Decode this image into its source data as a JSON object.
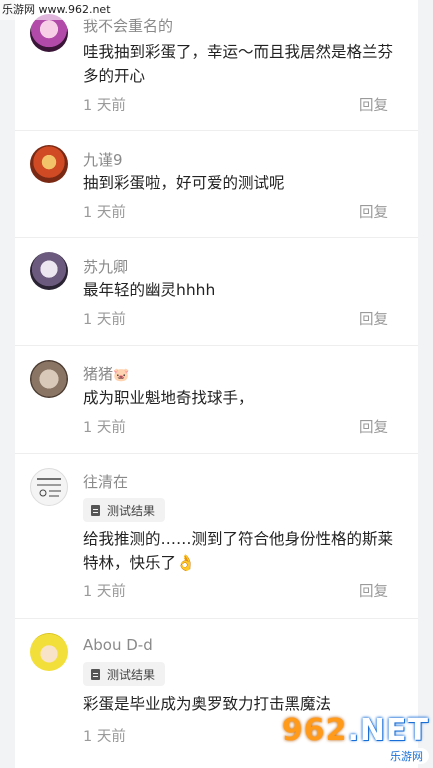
{
  "watermark": "乐游网 www.962.net",
  "reply_label": "回复",
  "tag_label": "测试结果",
  "comments": [
    {
      "name": "我不会重名的",
      "text": "哇我抽到彩蛋了，幸运～而且我居然是格兰芬多的开心",
      "time": "1 天前"
    },
    {
      "name": "九谨9",
      "text": "抽到彩蛋啦，好可爱的测试呢",
      "time": "1 天前"
    },
    {
      "name": "苏九卿",
      "text": "最年轻的幽灵hhhh",
      "time": "1 天前"
    },
    {
      "name": "猪猪",
      "name_emoji": "🐷",
      "text": "成为职业魁地奇找球手，",
      "time": "1 天前"
    },
    {
      "name": "往清在",
      "text": "给我推测的……测到了符合他身份性格的斯莱特林，快乐了👌",
      "time": "1 天前"
    },
    {
      "name": "Abou D-d",
      "text": "彩蛋是毕业成为奥罗致力打击黑魔法",
      "time": "1 天前"
    }
  ],
  "logo": {
    "text_main": "962",
    "text_suffix": ".NET",
    "subtitle": "乐游网"
  },
  "colors": {
    "background": "#f2f3f5",
    "card": "#ffffff",
    "muted": "#9a9a9a",
    "logo_blue": "#1a6fd6",
    "logo_orange": "#ff9a1a"
  }
}
